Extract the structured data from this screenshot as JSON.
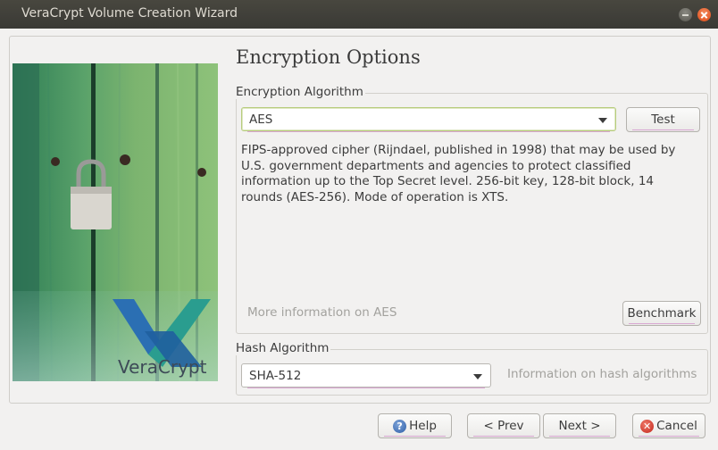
{
  "window": {
    "title": "VeraCrypt Volume Creation Wizard"
  },
  "page": {
    "heading": "Encryption Options"
  },
  "encryption": {
    "group_label": "Encryption Algorithm",
    "selected": "AES",
    "test_label": "Test",
    "description": "FIPS-approved cipher (Rijndael, published in 1998) that may be used by U.S. government departments and agencies to protect classified information up to the Top Secret level. 256-bit key, 128-bit block, 14 rounds (AES-256). Mode of operation is XTS.",
    "more_info": "More information on AES",
    "benchmark_label": "Benchmark"
  },
  "hash": {
    "group_label": "Hash Algorithm",
    "selected": "SHA-512",
    "info_link": "Information on hash algorithms"
  },
  "buttons": {
    "help": "Help",
    "prev": "< Prev",
    "next": "Next >",
    "cancel": "Cancel"
  },
  "banner": {
    "logo_text": "VeraCrypt"
  },
  "colors": {
    "accent_green": "#b7cc7d",
    "focus_underline": "#d9a7d2",
    "titlebar": "#3c3b37",
    "close_button": "#df4a16",
    "logo_blue": "#2b6fb3",
    "logo_teal": "#2a9d8f"
  },
  "icons": {
    "help": "help-icon",
    "cancel": "cancel-icon",
    "close": "close-icon",
    "minimize": "minimize-icon"
  }
}
